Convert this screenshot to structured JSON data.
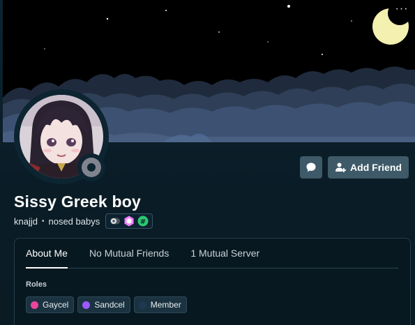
{
  "header": {
    "more_label": "···"
  },
  "profile": {
    "display_name": "Sissy Greek boy",
    "username": "knajjd",
    "separator": "•",
    "pronouns": "nosed babys",
    "status": "offline"
  },
  "actions": {
    "add_friend_label": "Add Friend",
    "message_icon": "chat-bubble-icon",
    "add_friend_icon": "person-add-icon"
  },
  "badges": [
    {
      "name": "toggle-badge-icon",
      "color": "#b9bbbe"
    },
    {
      "name": "hypesquad-hexagon-icon",
      "color": "#f47fff"
    },
    {
      "name": "hashtag-badge-icon",
      "color": "#2dc770"
    }
  ],
  "tabs": [
    {
      "label": "About Me",
      "active": true
    },
    {
      "label": "No Mutual Friends",
      "active": false
    },
    {
      "label": "1 Mutual Server",
      "active": false
    }
  ],
  "roles": {
    "heading": "Roles",
    "items": [
      {
        "label": "Gaycel",
        "color": "#eb459e"
      },
      {
        "label": "Sandcel",
        "color": "#9b59ff"
      },
      {
        "label": "Member",
        "color": "#1d3a52"
      }
    ]
  },
  "colors": {
    "background": "#0d2431",
    "button": "#3e5a68",
    "banner_sky": "#000000",
    "moon": "#f3f0b0",
    "clouds": "#2f3f57"
  }
}
